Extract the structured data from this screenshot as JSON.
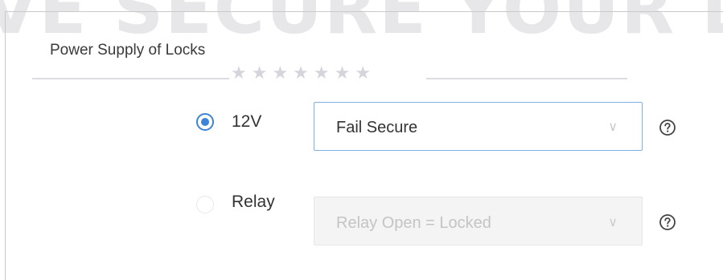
{
  "watermark": {
    "text": "VE SECURE YOUR LIFE",
    "stars": "★★★★★★★"
  },
  "section": {
    "title": "Power Supply of Locks"
  },
  "options": [
    {
      "label": "12V",
      "selected": true,
      "dropdown": {
        "value": "Fail Secure",
        "enabled": true
      }
    },
    {
      "label": "Relay",
      "selected": false,
      "dropdown": {
        "value": "Relay Open = Locked",
        "enabled": false
      }
    }
  ],
  "icons": {
    "help": "help-circle-icon",
    "chevron": "chevron-down-icon"
  },
  "colors": {
    "accent": "#3d83d6",
    "active_border": "#7fb0e5",
    "disabled_bg": "#f4f4f4",
    "disabled_text": "#c4c4c4"
  }
}
